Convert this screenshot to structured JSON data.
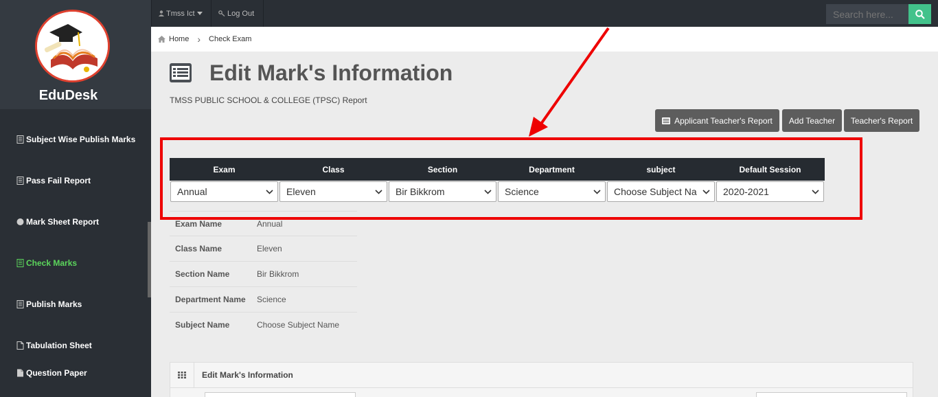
{
  "app": {
    "name": "EduDesk"
  },
  "sidebar": {
    "items": [
      {
        "label": "Subject Wise Publish Marks",
        "icon": "document-icon",
        "active": false
      },
      {
        "label": "Pass Fail Report",
        "icon": "document-icon",
        "active": false
      },
      {
        "label": "Mark Sheet Report",
        "icon": "circle-icon",
        "active": false
      },
      {
        "label": "Check Marks",
        "icon": "document-icon",
        "active": true
      },
      {
        "label": "Publish Marks",
        "icon": "document-icon",
        "active": false
      },
      {
        "label": "Tabulation Sheet",
        "icon": "file-icon",
        "active": false
      },
      {
        "label": "Question Paper",
        "icon": "file-icon",
        "active": false
      }
    ]
  },
  "topbar": {
    "user_label": "Tmss Ict",
    "logout_label": "Log Out",
    "search_placeholder": "Search here..."
  },
  "breadcrumb": {
    "home": "Home",
    "current": "Check Exam"
  },
  "header": {
    "title": "Edit Mark's Information",
    "report_text": "TMSS PUBLIC SCHOOL & COLLEGE (TPSC) Report"
  },
  "buttons": {
    "applicant_report": "Applicant Teacher's Report",
    "add_teacher": "Add Teacher",
    "teacher_report": "Teacher's Report"
  },
  "filters": {
    "headers": [
      "Exam",
      "Class",
      "Section",
      "Department",
      "subject",
      "Default Session"
    ],
    "values": [
      "Annual",
      "Eleven",
      "Bir Bikkrom",
      "Science",
      "Choose Subject Na",
      "2020-2021"
    ]
  },
  "info": [
    {
      "label": "Exam Name",
      "value": "Annual"
    },
    {
      "label": "Class Name",
      "value": "Eleven"
    },
    {
      "label": "Section Name",
      "value": "Bir Bikkrom"
    },
    {
      "label": "Department Name",
      "value": "Science"
    },
    {
      "label": "Subject Name",
      "value": "Choose Subject Name"
    }
  ],
  "panel": {
    "title": "Edit Mark's Information"
  },
  "colors": {
    "highlight": "#ee0000",
    "active_menu": "#5cd65c",
    "search_button": "#42c28b"
  }
}
